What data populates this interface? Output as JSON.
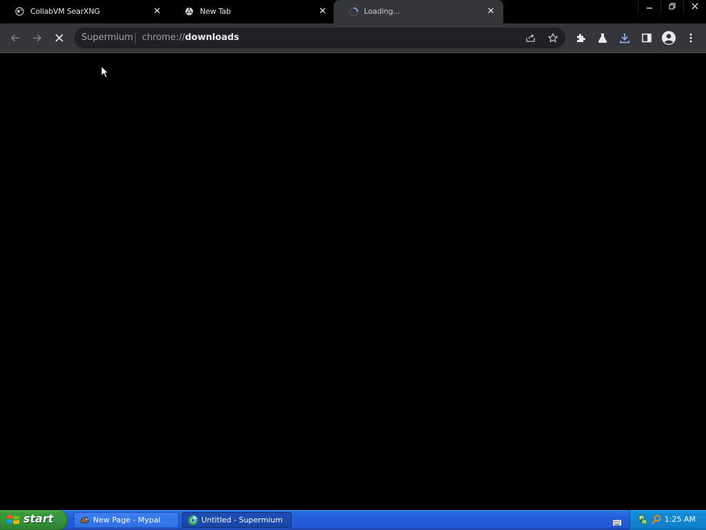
{
  "tabs": [
    {
      "title": "CollabVM SearXNG",
      "icon": "globe-icon",
      "active": false
    },
    {
      "title": "New Tab",
      "icon": "chromium-icon",
      "active": false
    },
    {
      "title": "Loading...",
      "icon": "loading-spinner-icon",
      "active": true
    }
  ],
  "window_controls": [
    "minimize-icon",
    "restore-icon",
    "close-icon"
  ],
  "toolbar": {
    "back": "back-arrow-icon",
    "forward": "forward-arrow-icon",
    "stop": "stop-icon",
    "right_icons": [
      "extensions-icon",
      "labs-icon",
      "download-icon",
      "side-panel-icon",
      "profile-icon",
      "menu-icon"
    ]
  },
  "omnibox": {
    "site_name": "Supermium",
    "url_scheme": "chrome://",
    "url_host": "downloads",
    "icons": [
      "share-icon",
      "bookmark-star-icon"
    ]
  },
  "colors": {
    "page_background": "#000000",
    "toolbar": "#35363a",
    "omnibox": "#202124",
    "download_accent": "#8ab4f8",
    "taskbar": "#245edb",
    "start_button": "#3c9a3c"
  },
  "taskbar": {
    "start_label": "start",
    "tasks": [
      {
        "label": "New Page - Mypal",
        "icon": "mypal-icon",
        "active": false
      },
      {
        "label": "Untitled - Supermium",
        "icon": "supermium-icon",
        "active": true
      }
    ],
    "tray_icons": [
      "keyboard-icon",
      "network-icon",
      "search-icon"
    ],
    "clock": "1:25 AM"
  }
}
